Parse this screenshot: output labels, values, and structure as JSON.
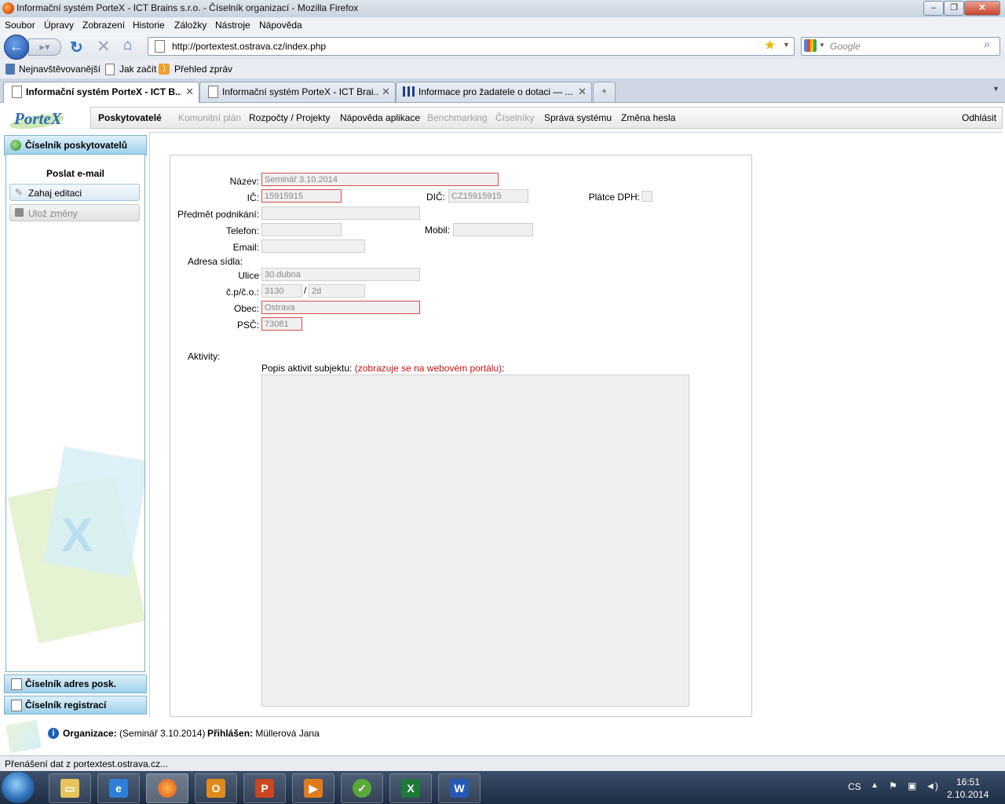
{
  "window": {
    "title": "Informační systém PorteX - ICT Brains s.r.o. - Číselník organizací - Mozilla Firefox",
    "minimize": "–",
    "maximize": "❐",
    "close": "✕"
  },
  "menu": [
    "Soubor",
    "Úpravy",
    "Zobrazení",
    "Historie",
    "Záložky",
    "Nástroje",
    "Nápověda"
  ],
  "nav": {
    "url": "http://portextest.ostrava.cz/index.php",
    "search_placeholder": "Google"
  },
  "bookmarks": [
    "Nejnavštěvovanější",
    "Jak začít",
    "Přehled zpráv"
  ],
  "tabs": [
    {
      "label": "Informační systém PorteX - ICT B..."
    },
    {
      "label": "Informační systém PorteX - ICT Brai..."
    },
    {
      "label": "Informace pro žadatele o dotaci — ..."
    }
  ],
  "tab_new": "+",
  "app": {
    "logo_text": "PorteX",
    "nav": [
      {
        "label": "Poskytovatelé",
        "active": true
      },
      {
        "label": "Komunitní plán",
        "disabled": true
      },
      {
        "label": "Rozpočty / Projekty"
      },
      {
        "label": "Nápověda aplikace"
      },
      {
        "label": "Benchmarking",
        "disabled": true
      },
      {
        "label": "Číselníky",
        "disabled": true
      },
      {
        "label": "Správa systému"
      },
      {
        "label": "Změna hesla"
      }
    ],
    "logout": "Odhlásit"
  },
  "sidebar": {
    "header": "Číselník poskytovatelů",
    "section_title": "Poslat e-mail",
    "buttons": [
      "Zahaj editaci",
      "Ulož změny"
    ],
    "sections": [
      "Číselník adres posk.",
      "Číselník registrací"
    ]
  },
  "form": {
    "nazev_label": "Název:",
    "nazev": "Seminář 3.10.2014",
    "ic_label": "IČ:",
    "ic": "15915915",
    "dic_label": "DIČ:",
    "dic": "CZ15915915",
    "platce_label": "Plátce DPH:",
    "predmet_label": "Předmět podnikání:",
    "predmet": "",
    "telefon_label": "Telefon:",
    "telefon": "",
    "mobil_label": "Mobil:",
    "mobil": "",
    "email_label": "Email:",
    "email": "",
    "adresa_label": "Adresa sídla:",
    "ulice_label": "Ulice",
    "ulice": "30.dubna",
    "cp_label": "č.p/č.o.:",
    "cp": "3130",
    "co_sep": "/",
    "co": "2d",
    "obec_label": "Obec:",
    "obec": "Ostrava",
    "psc_label": "PSČ:",
    "psc": "73081",
    "aktivity_label": "Aktivity:",
    "popis_label": "Popis aktivit subjektu:",
    "popis_note": "(zobrazuje se na webovém portálu)",
    "popis_colon": ":"
  },
  "footer": {
    "org_label": "Organizace:",
    "org_value": "(Seminář 3.10.2014)",
    "user_label": "Přihlášen:",
    "user_value": "Müllerová Jana"
  },
  "status": "Přenášení dat z portextest.ostrava.cz...",
  "taskbar": {
    "lang": "CS",
    "time": "16:51",
    "date": "2.10.2014"
  },
  "colors": {
    "required_border": "#d94b4b",
    "note_red": "#d01010",
    "sidebar_accent": "#9cd0ea"
  }
}
